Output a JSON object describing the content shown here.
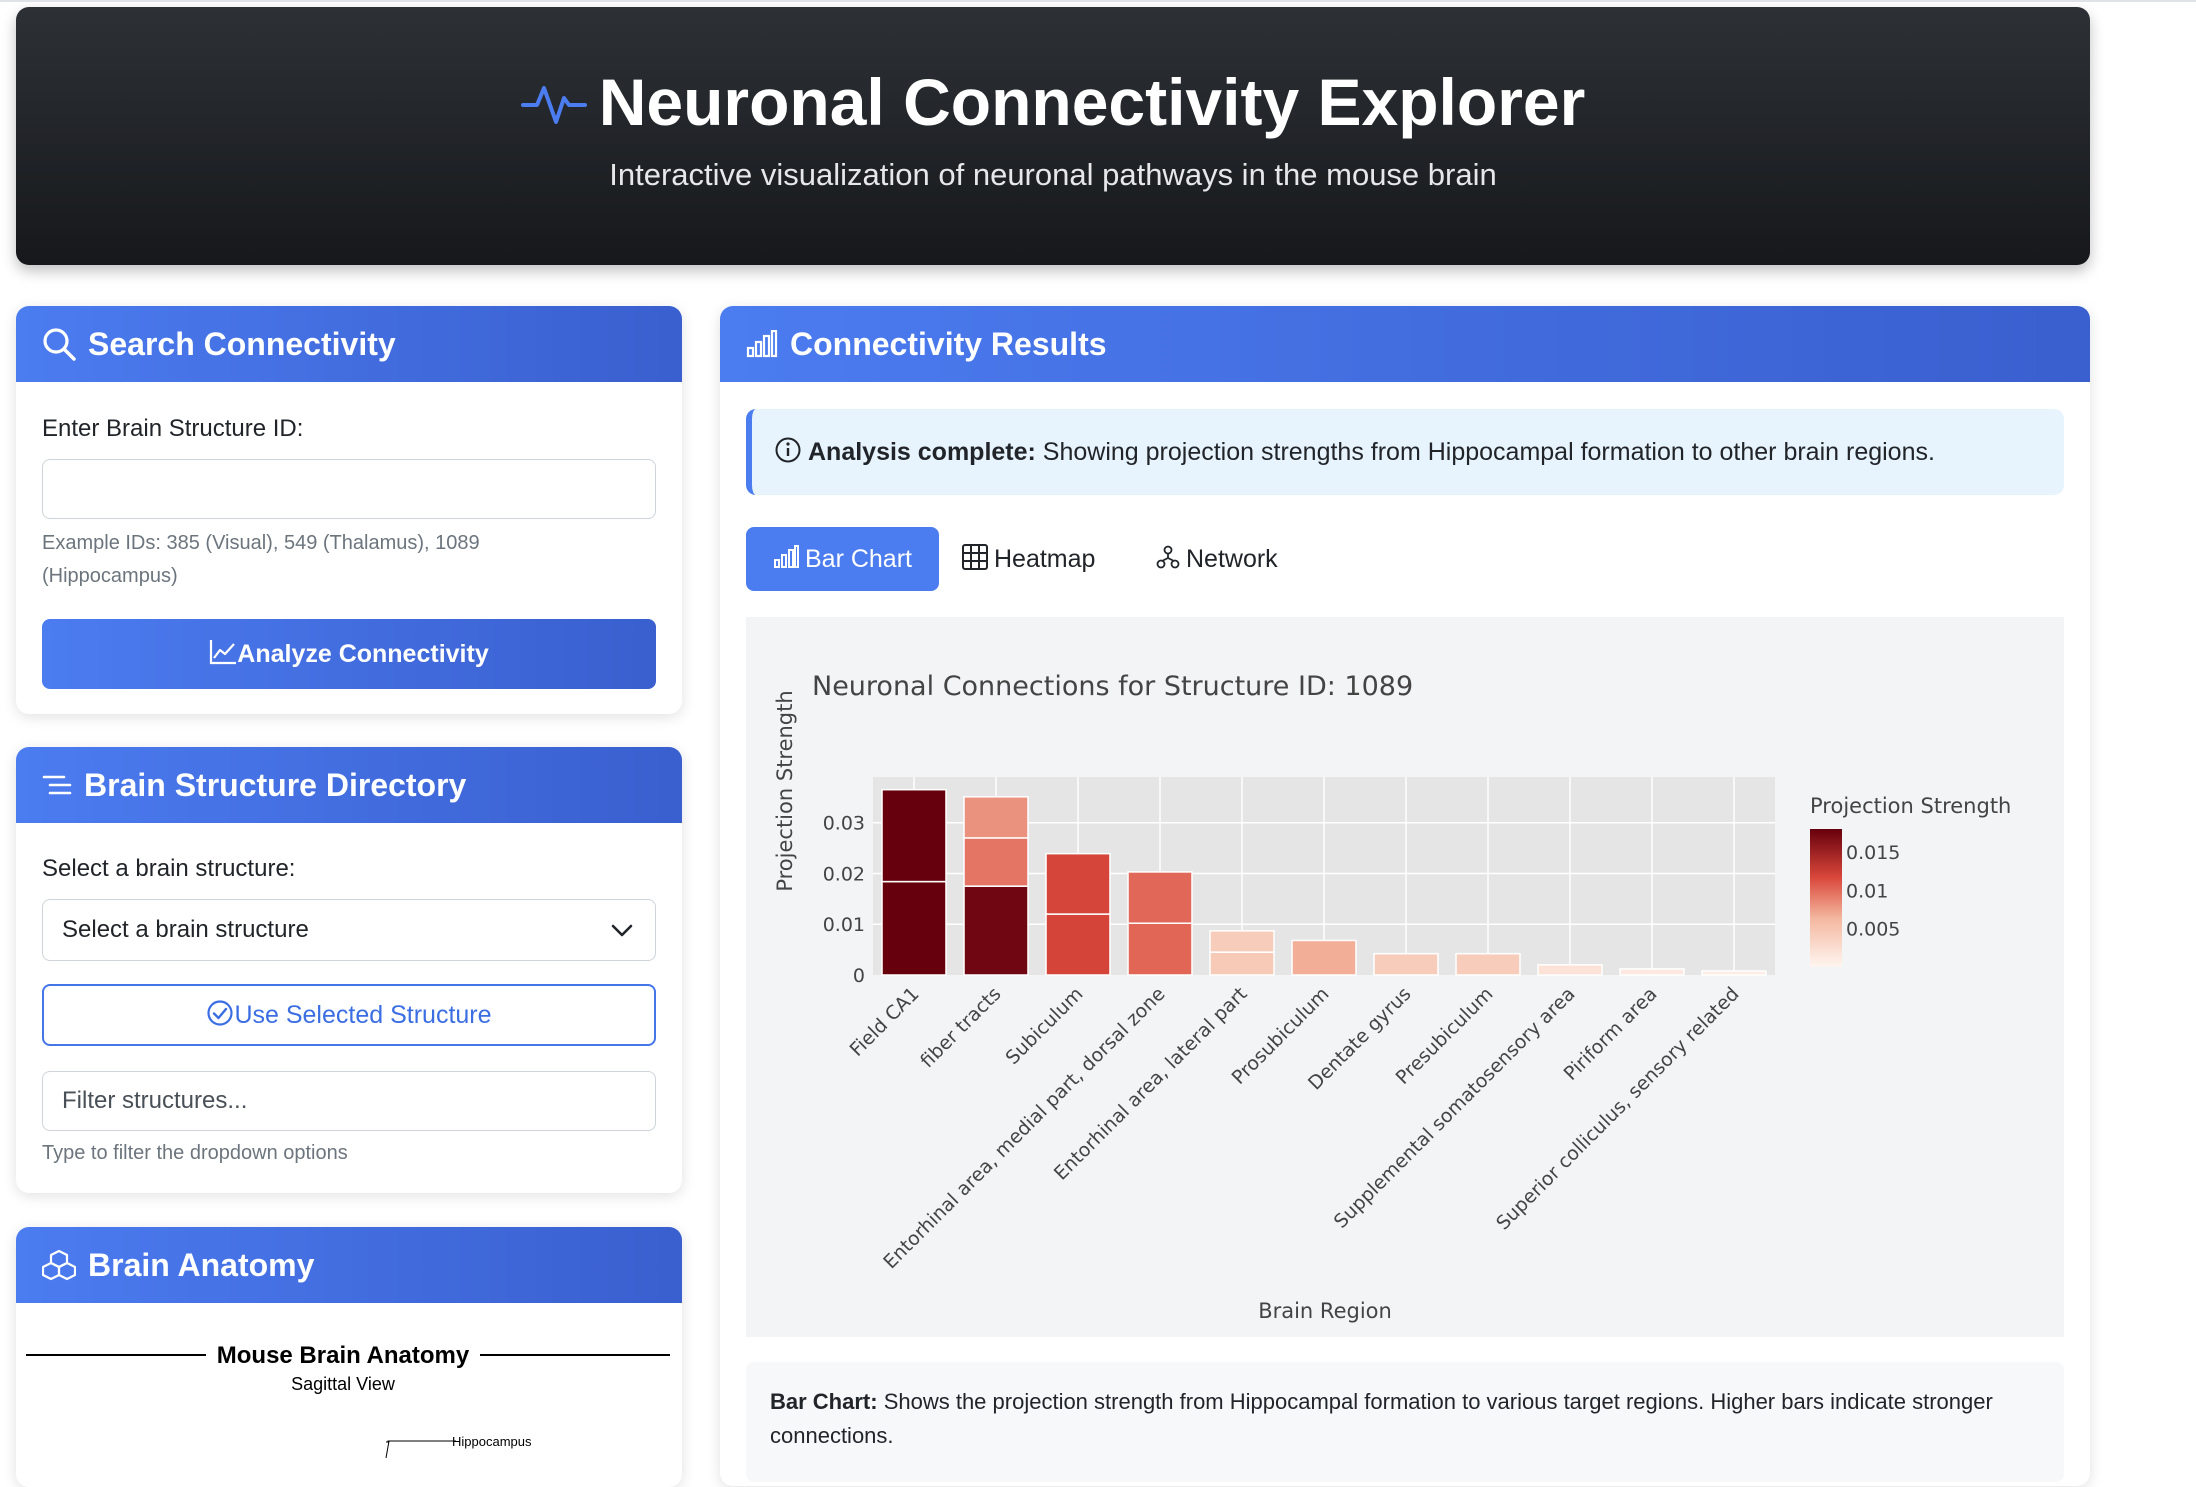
{
  "header": {
    "title": "Neuronal Connectivity Explorer",
    "subtitle": "Interactive visualization of neuronal pathways in the mouse brain",
    "icon": "activity-pulse-icon"
  },
  "search_card": {
    "title": "Search Connectivity",
    "icon": "search-icon",
    "input_label": "Enter Brain Structure ID:",
    "input_value": "",
    "hint_line1": "Example IDs: 385 (Visual), 549 (Thalamus), 1089",
    "hint_line2": "(Hippocampus)",
    "analyze_button": "Analyze Connectivity"
  },
  "directory_card": {
    "title": "Brain Structure Directory",
    "icon": "list-icon",
    "select_label": "Select a brain structure:",
    "select_value": "Select a brain structure",
    "use_button": "Use Selected Structure",
    "filter_placeholder": "Filter structures...",
    "filter_hint": "Type to filter the dropdown options"
  },
  "anatomy_card": {
    "title": "Brain Anatomy",
    "icon": "boxes-icon",
    "figure_title": "Mouse Brain Anatomy",
    "figure_subtitle": "Sagittal View",
    "callout_label": "Hippocampus"
  },
  "results_card": {
    "title": "Connectivity Results",
    "icon": "bar-chart-icon",
    "alert_bold": "Analysis complete:",
    "alert_text": " Showing projection strengths from Hippocampal formation to other brain regions.",
    "tabs": [
      {
        "label": "Bar Chart",
        "icon": "bar-chart-icon",
        "active": true
      },
      {
        "label": "Heatmap",
        "icon": "grid-icon",
        "active": false
      },
      {
        "label": "Network",
        "icon": "network-icon",
        "active": false
      }
    ],
    "description_bold": "Bar Chart:",
    "description_text": " Shows the projection strength from Hippocampal formation to various target regions. Higher bars indicate stronger connections."
  },
  "colors": {
    "accent": "#4b7cf0",
    "accent_dark": "#3a5fcf",
    "header_bg": "#1e2124",
    "alert_bg": "#e8f4fd"
  },
  "chart_data": {
    "type": "bar",
    "title": "Neuronal Connections for Structure ID: 1089",
    "xlabel": "Brain Region",
    "ylabel": "Projection Strength",
    "ylim": [
      0,
      0.039
    ],
    "yticks": [
      0,
      0.01,
      0.02,
      0.03
    ],
    "ytick_labels": [
      "0",
      "0.01",
      "0.02",
      "0.03"
    ],
    "grid": true,
    "colorbar": {
      "title": "Projection Strength",
      "range": [
        0,
        0.018
      ],
      "ticks": [
        0.005,
        0.01,
        0.015
      ],
      "tick_labels": [
        "0.005",
        "0.01",
        "0.015"
      ],
      "placement": "right"
    },
    "categories": [
      "Field CA1",
      "fiber tracts",
      "Subiculum",
      "Entorhinal area, medial part, dorsal zone",
      "Entorhinal area, lateral part",
      "Prosubiculum",
      "Dentate gyrus",
      "Presubiculum",
      "Supplemental somatosensory area",
      "Piriform area",
      "Superior colliculus, sensory related"
    ],
    "segments": [
      [
        0.0184,
        0.0181
      ],
      [
        0.0175,
        0.0095,
        0.0081
      ],
      [
        0.012,
        0.0119
      ],
      [
        0.0102,
        0.0101
      ],
      [
        0.0045,
        0.0042
      ],
      [
        0.0068
      ],
      [
        0.0042
      ],
      [
        0.0042
      ],
      [
        0.002
      ],
      [
        0.0012
      ],
      [
        0.0008
      ]
    ]
  }
}
